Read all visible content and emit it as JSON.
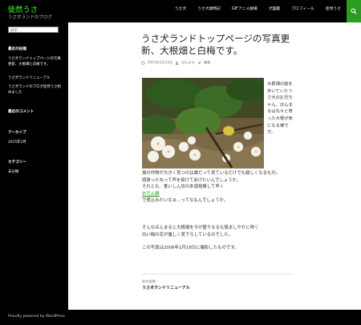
{
  "header": {
    "site_title": "徒然うさ",
    "site_description": "うさ犬ランドのブログ",
    "nav": [
      "うさ犬",
      "うさ犬歳時記",
      "GIFアニメ劇場",
      "犬図鑑",
      "プロフィール",
      "徒然うさ"
    ],
    "search_icon": "search-icon",
    "accent_color": "#2fb21f"
  },
  "sidebar": {
    "search_placeholder": "検索 …",
    "recent_posts_title": "最近の投稿",
    "recent_posts": [
      "うさ犬ランドトップページの写真更新、大根畑と白梅です。",
      "うさ犬ランドリニューアル",
      "うさ犬ランドのブログ徒然うさ始めました"
    ],
    "recent_comments_title": "最近のコメント",
    "archives_title": "アーカイブ",
    "archives": [
      "2015年2月"
    ],
    "categories_title": "カテゴリー",
    "categories": [
      "未分類"
    ]
  },
  "post": {
    "title": "うさ犬ランドトップページの写真更新、大根畑と白梅です。",
    "date": "2015年2月14日",
    "author": "ぱんまる",
    "edit": "編集",
    "side_text": "大根畑の脇を歩いていたうさ犬のお兄ちゃん。ほんまるは丸々と育った大根が気になる様です。",
    "p1_lines": [
      "畑の作物が大きく育つのは誰だって見ているだけでも嬉しくなるもの。",
      "頑張ったねって声を掛けてあげたいんでしょうか。",
      "それとも、食いしん坊の本領発揮して早く"
    ],
    "p1_link": "おでん鍋",
    "p1_tail": "で煮込みたいなぁ…ってなもんでしょうか。",
    "p2_lines": [
      "そんなほんまると大根畑を今が盛りなるも慎ましやかに咲く",
      "白い梅の花が優しく見下ろしているのでした。"
    ],
    "p3": "この写真は2006年2月18日に撮影したものです。",
    "post_nav_label": "前の投稿",
    "post_nav_link": "うさ犬ランドリニューアル"
  },
  "footer": {
    "text": "Proudly powered by WordPress"
  }
}
